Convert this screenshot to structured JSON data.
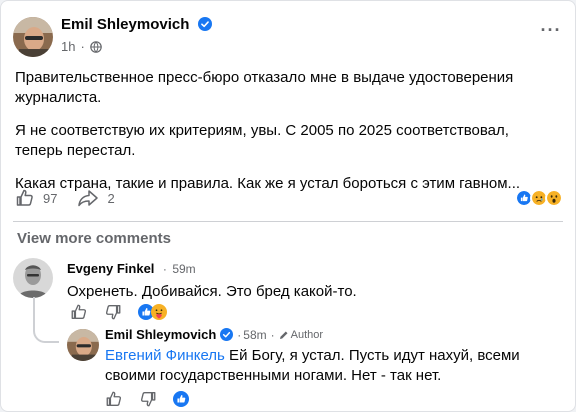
{
  "post": {
    "author": "Emil Shleymovich",
    "time": "1h",
    "paragraphs": [
      "Правительственное пресс-бюро отказало мне в выдаче удостоверения журналиста.",
      "Я не соответствую их критериям, увы. С 2005 по 2025 соответствовал, теперь перестал.",
      "Какая страна, такие и правила. Как же я устал бороться с этим гавном..."
    ],
    "like_count": "97",
    "share_count": "2",
    "more_label": "···"
  },
  "comments": {
    "view_more": "View more comments",
    "first": {
      "author": "Evgeny Finkel",
      "time": "59m",
      "text": "Охренеть. Добивайся. Это бред какой-то."
    },
    "reply": {
      "author": "Emil Shleymovich",
      "time": "58m",
      "badge": "Author",
      "mention": "Евгений Финкель",
      "text": " Ей Богу, я устал. Пусть идут нахуй, всеми своими государственными ногами. Нет - так нет."
    }
  },
  "colors": {
    "accent": "#1877f2",
    "secondary_text": "#65676b",
    "primary_text": "#050505"
  },
  "icons": [
    "verified-badge-icon",
    "globe-icon",
    "like-icon",
    "share-icon",
    "like-reaction-icon",
    "sad-reaction-icon",
    "wow-reaction-icon",
    "care-reaction-icon",
    "dislike-icon",
    "author-pen-icon",
    "more-options-icon"
  ]
}
